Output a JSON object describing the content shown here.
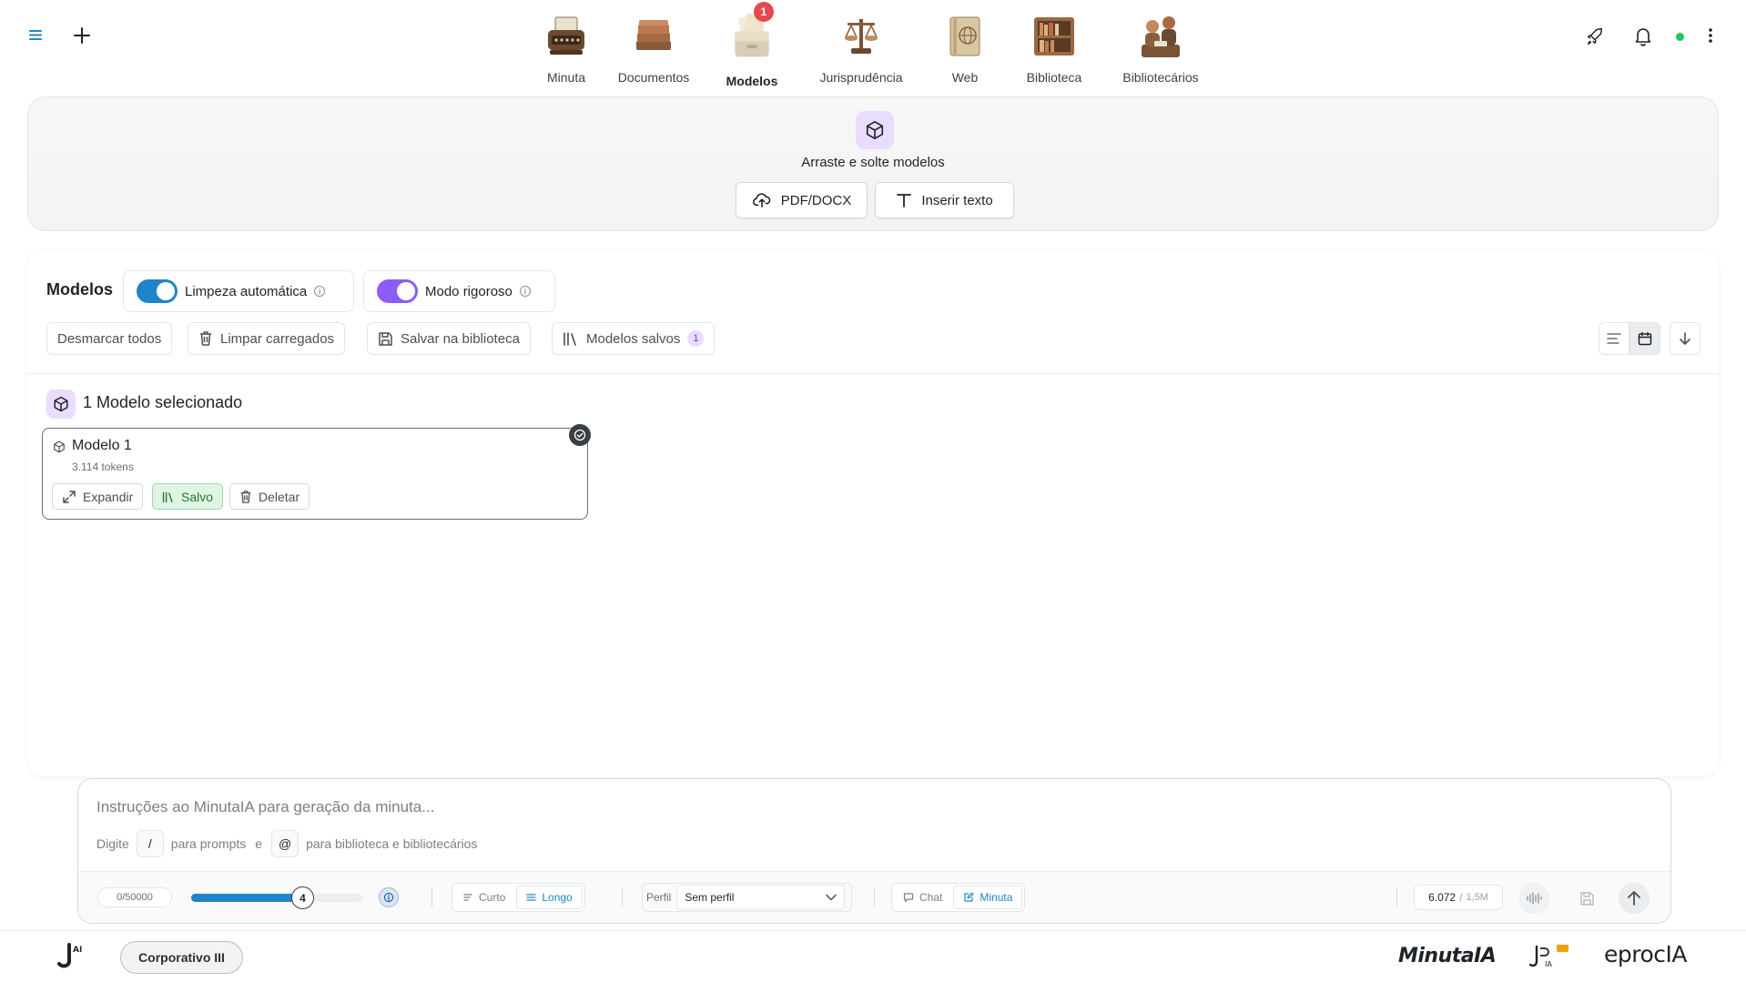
{
  "nav": {
    "tabs": [
      {
        "label": "Minuta",
        "icon": "typewriter-icon"
      },
      {
        "label": "Documentos",
        "icon": "documents-icon"
      },
      {
        "label": "Modelos",
        "icon": "file-box-icon",
        "badge": "1",
        "active": true
      },
      {
        "label": "Jurisprudência",
        "icon": "scales-icon"
      },
      {
        "label": "Web",
        "icon": "web-book-icon"
      },
      {
        "label": "Biblioteca",
        "icon": "bookshelf-icon"
      },
      {
        "label": "Bibliotecários",
        "icon": "librarians-icon"
      }
    ]
  },
  "dropzone": {
    "text": "Arraste e solte modelos",
    "upload_label": "PDF/DOCX",
    "insert_label": "Inserir texto"
  },
  "models": {
    "title": "Modelos",
    "auto_clean_label": "Limpeza automática",
    "strict_mode_label": "Modo rigoroso",
    "toolbar": {
      "unselect_all": "Desmarcar todos",
      "clear_loaded": "Limpar carregados",
      "save_library": "Salvar na biblioteca",
      "saved_models": "Modelos salvos",
      "saved_count": "1"
    },
    "selected_text": "1 Modelo selecionado",
    "cards": [
      {
        "title": "Modelo 1",
        "tokens": "3.114 tokens",
        "expand": "Expandir",
        "saved": "Salvo",
        "delete": "Deletar"
      }
    ]
  },
  "prompt": {
    "placeholder": "Instruções ao MinutaIA para geração da minuta...",
    "hint_prefix": "Digite",
    "hint_slash_key": "/",
    "hint_slash_text": "para prompts",
    "hint_and": "e",
    "hint_at_key": "@",
    "hint_at_text": "para biblioteca e bibliotecários",
    "char_counter": "0/50000",
    "slider_value": "4",
    "slider_fraction": 0.65,
    "length_short": "Curto",
    "length_long": "Longo",
    "perfil_label": "Perfil",
    "perfil_value": "Sem perfil",
    "mode_chat": "Chat",
    "mode_minuta": "Minuta",
    "tokens_used": "6.072",
    "tokens_sep": "/",
    "tokens_max": "1,5M"
  },
  "footer": {
    "profile_pill": "Corporativo III",
    "logo_minuta": "MinutaIA",
    "logo_eproc": "eprocIA"
  },
  "colors": {
    "accent_blue": "#1e86c8",
    "accent_purple": "#8b5cf6",
    "badge_red": "#e5484d",
    "status_green": "#22c55e",
    "saved_green": "#1f7a39"
  }
}
